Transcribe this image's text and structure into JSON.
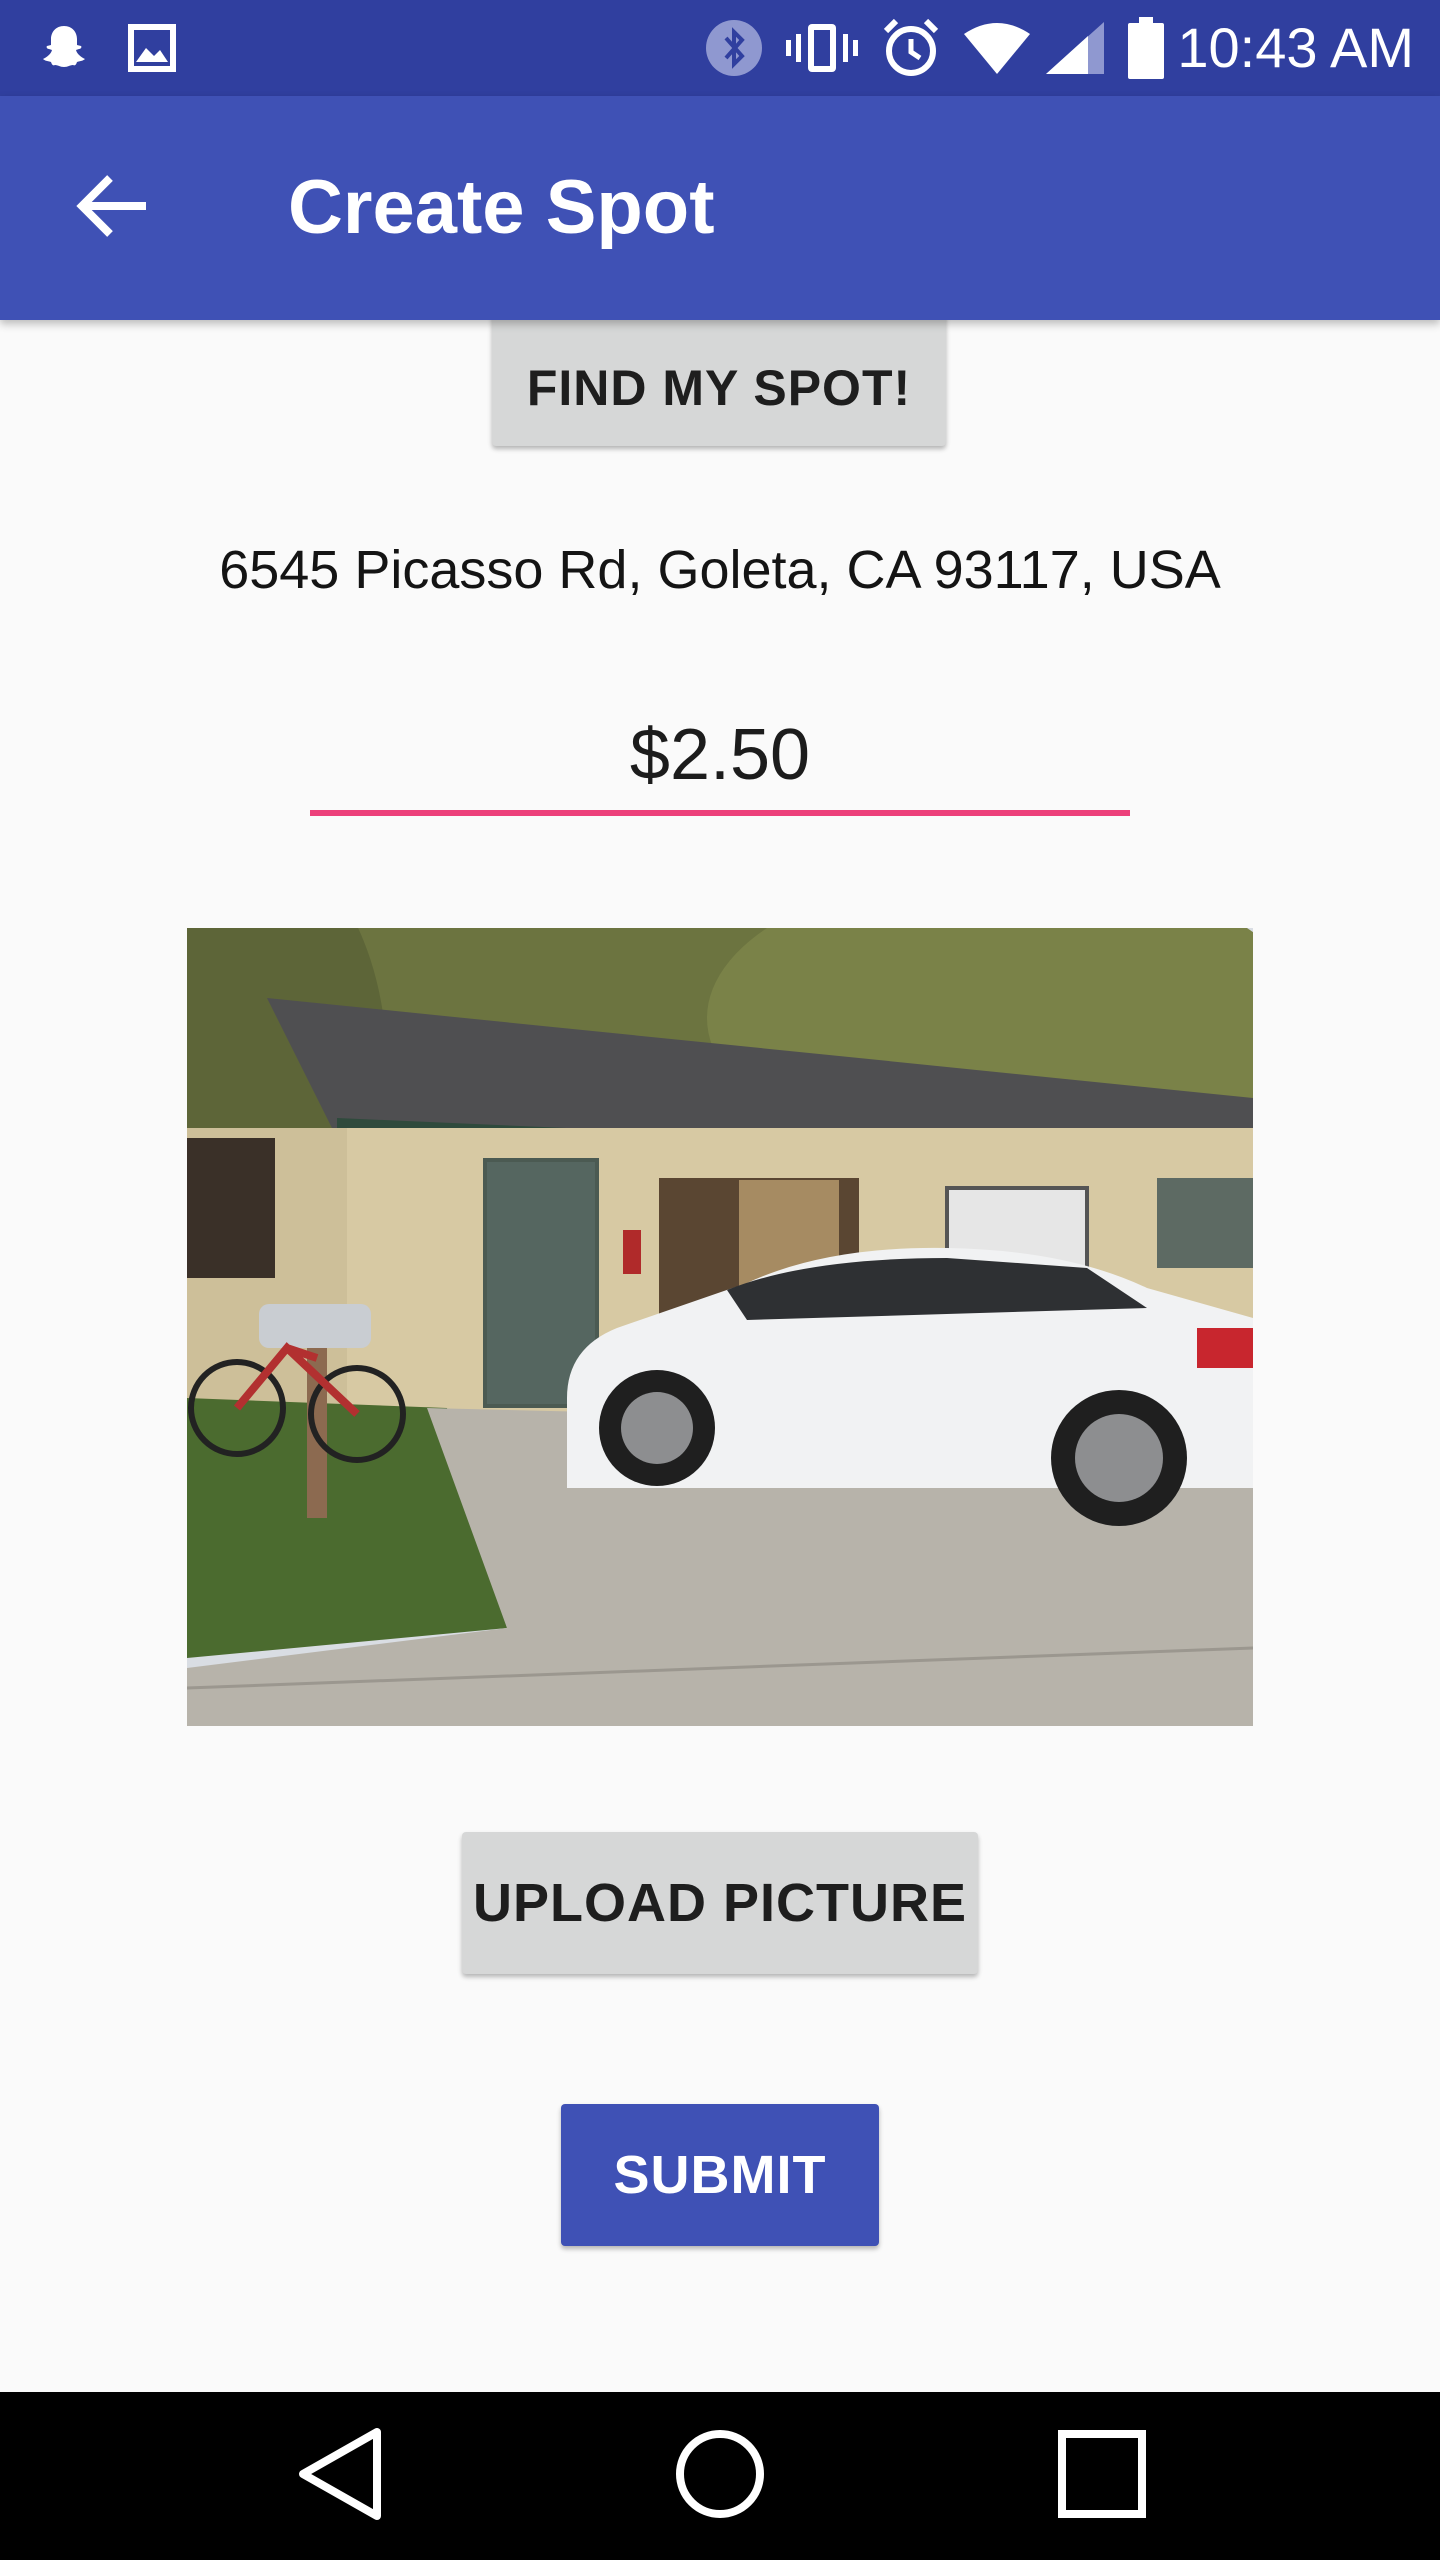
{
  "status_bar": {
    "time": "10:43 AM",
    "icons": [
      "snapchat-icon",
      "gallery-icon",
      "bluetooth-icon",
      "vibrate-icon",
      "alarm-icon",
      "wifi-icon",
      "signal-icon",
      "battery-icon"
    ]
  },
  "app_bar": {
    "title": "Create Spot",
    "back_icon": "back-arrow-icon"
  },
  "main": {
    "find_button_label": "FIND MY SPOT!",
    "address": "6545 Picasso Rd, Goleta, CA 93117, USA",
    "price_value": "$2.50",
    "upload_button_label": "UPLOAD PICTURE",
    "submit_button_label": "SUBMIT"
  },
  "nav_bar": {
    "icons": [
      "back-triangle-icon",
      "home-circle-icon",
      "recents-square-icon"
    ]
  },
  "colors": {
    "status_bar": "#303f9f",
    "app_bar": "#3f51b5",
    "accent": "#ec407a",
    "primary_button": "#3f51b5",
    "secondary_button": "#d6d7d7",
    "background": "#fafafa"
  }
}
